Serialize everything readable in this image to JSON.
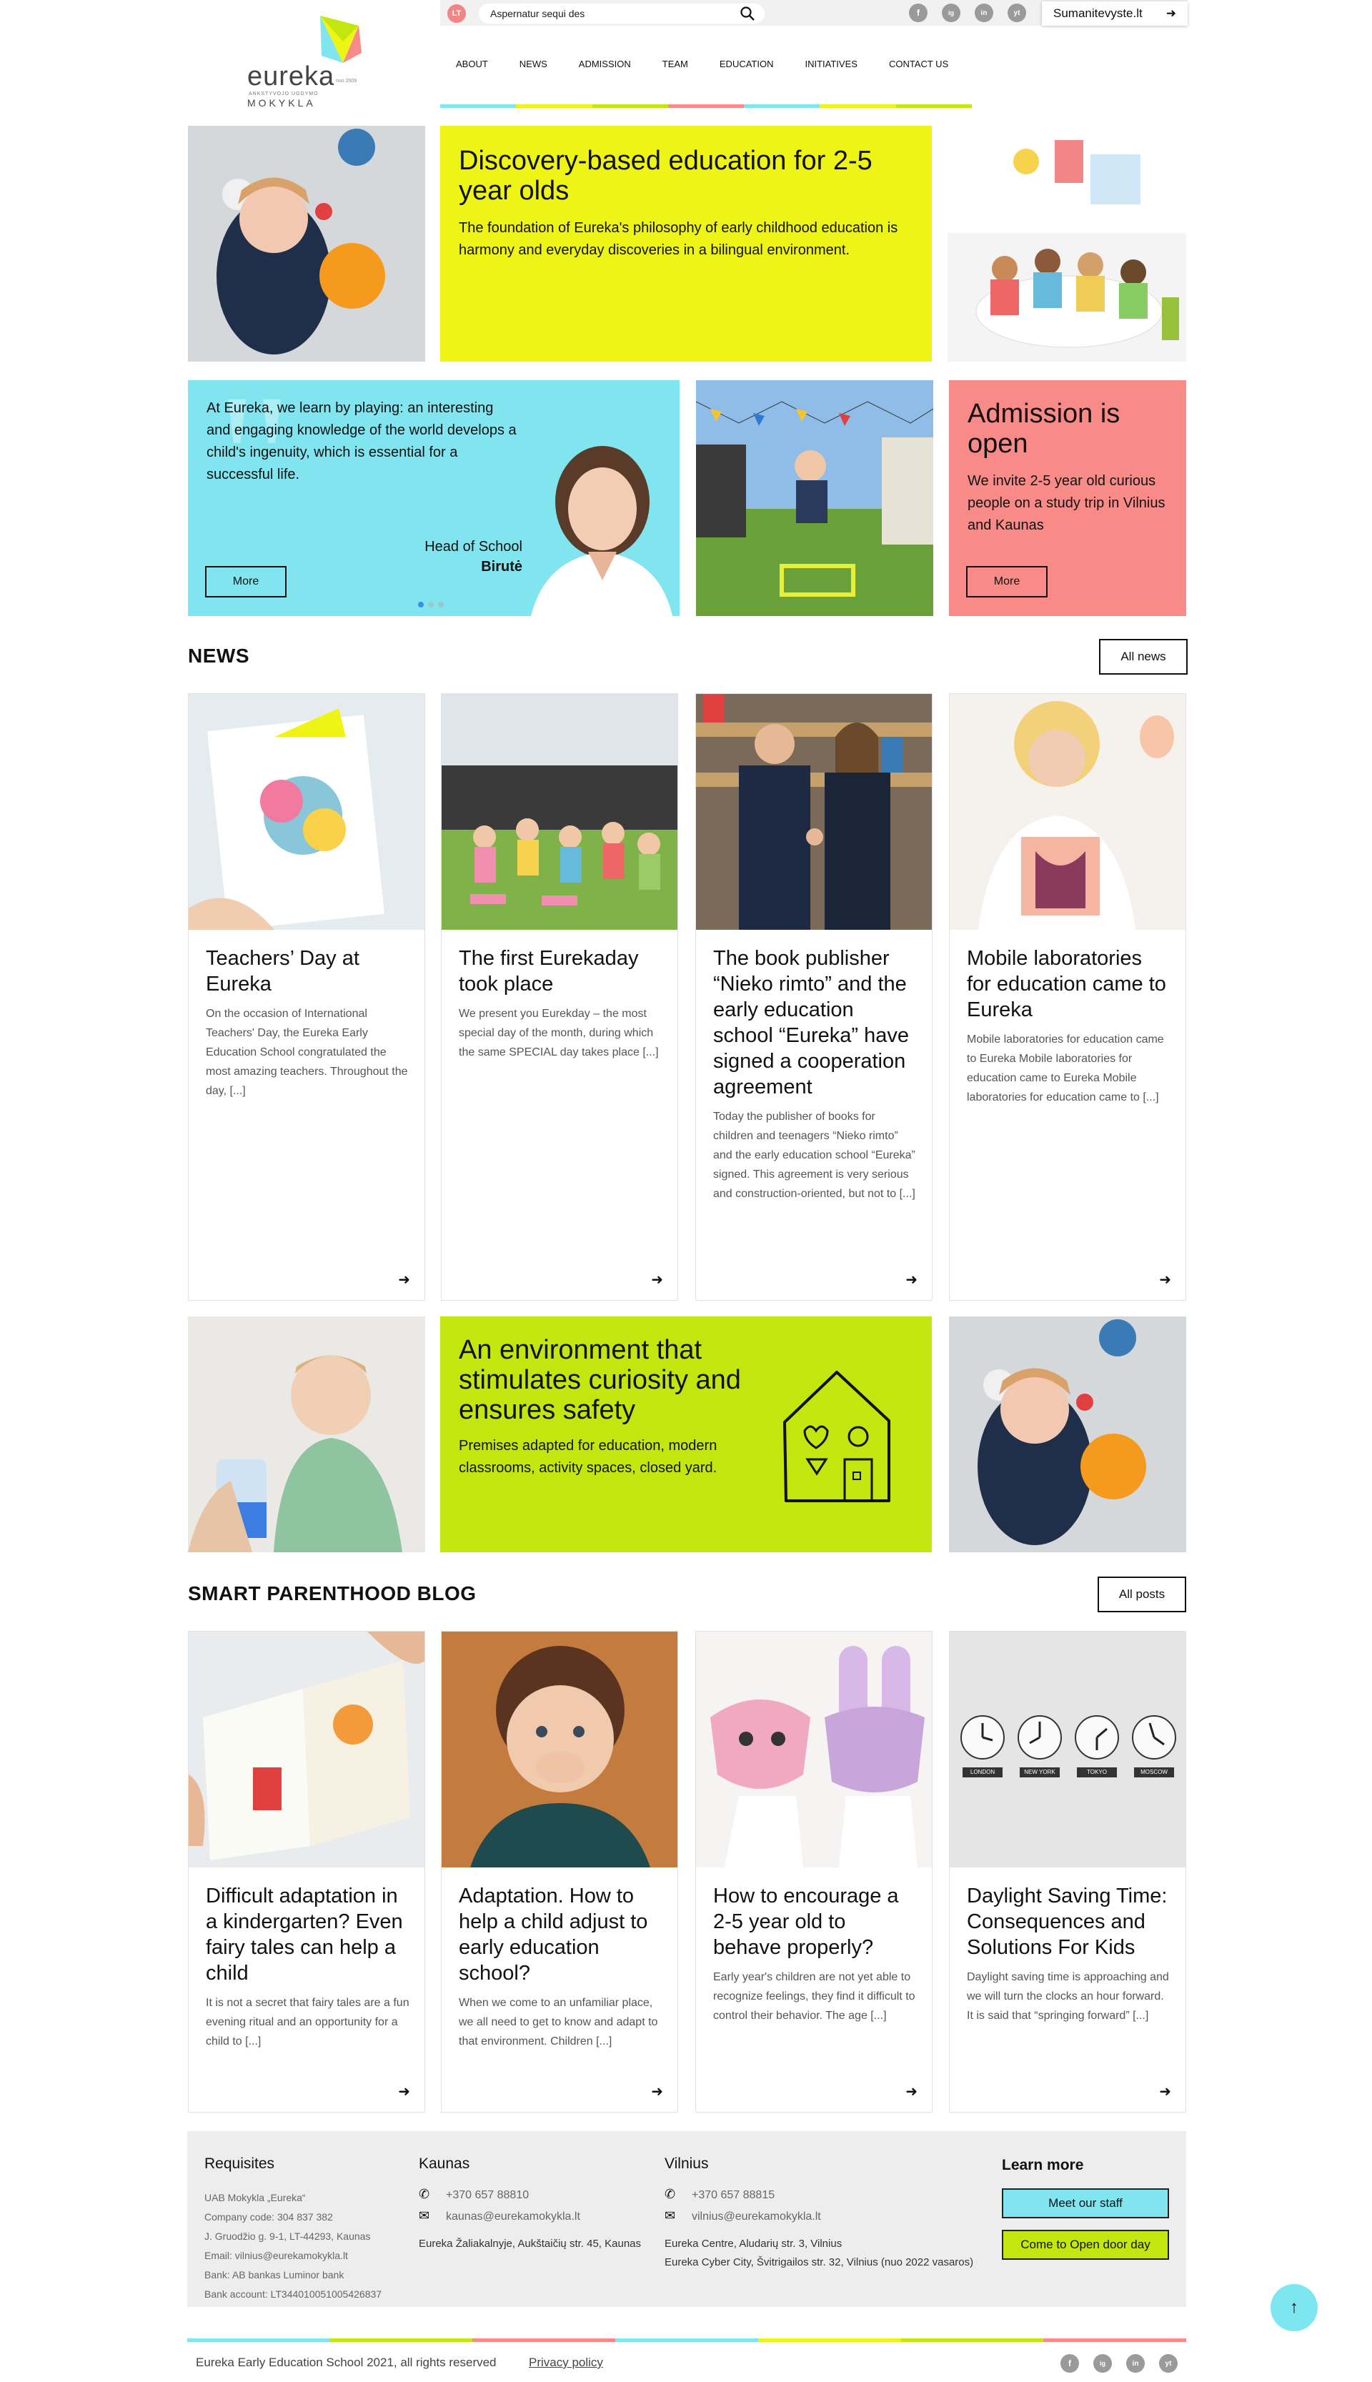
{
  "colors": {
    "yellow": "#eef514",
    "cyan": "#80e5ef",
    "salmon": "#f88a88",
    "lime": "#c4e60f",
    "blue": "#3d8fe0",
    "dark": "#111111"
  },
  "header": {
    "lang": "LT",
    "search_value": "Aspernatur sequi des",
    "social": [
      "f",
      "ig",
      "in",
      "yt"
    ],
    "external_link": "Sumanitevyste.lt",
    "logo_word": "eureka",
    "logo_small": "ANKSTYVOJO UGDYMO",
    "logo_school": "MOKYKLA",
    "logo_since": "nuo 2009",
    "nav": [
      "ABOUT",
      "NEWS",
      "ADMISSION",
      "TEAM",
      "EDUCATION",
      "INITIATIVES",
      "CONTACT US"
    ]
  },
  "hero": {
    "title": "Discovery-based education for 2-5 year olds",
    "text": "The foundation of Eureka's philosophy of early childhood education is harmony and everyday discoveries in a bilingual environment."
  },
  "quote": {
    "text": "At Eureka, we learn by playing: an interesting and engaging knowledge of the world develops a child's ingenuity, which is essential for a successful life.",
    "role": "Head of School",
    "name": "Birutė",
    "button": "More"
  },
  "admission": {
    "title": "Admission is open",
    "text": "We invite 2-5 year old curious people on a study trip in Vilnius and Kaunas",
    "button": "More"
  },
  "news": {
    "title": "NEWS",
    "all": "All news",
    "items": [
      {
        "title": "Teachers’ Day at Eureka",
        "text": "On the occasion of International Teachers' Day, the Eureka Early Education School congratulated the most amazing teachers. Throughout the day, [...]"
      },
      {
        "title": "The first Eurekaday took place",
        "text": "We present you Eurekday – the most special day of the month, during which the same SPECIAL day takes place [...]"
      },
      {
        "title": "The book publisher “Nieko rimto” and the early education school “Eureka” have signed a cooperation agreement",
        "text": "Today the publisher of books for children and teenagers “Nieko rimto” and the early education school “Eureka” signed. This agreement is very serious and construction-oriented, but not to [...]"
      },
      {
        "title": "Mobile laboratories for education came to Eureka",
        "text": "Mobile laboratories for education came to Eureka Mobile laboratories for education came to Eureka Mobile laboratories for education came to [...]"
      }
    ]
  },
  "environment": {
    "title": "An environment that stimulates curiosity and ensures safety",
    "text": "Premises adapted for education, modern classrooms, activity spaces, closed yard."
  },
  "blog": {
    "title": "SMART PARENTHOOD BLOG",
    "all": "All posts",
    "clock_labels": [
      "LONDON",
      "NEW YORK",
      "TOKYO",
      "MOSCOW"
    ],
    "items": [
      {
        "title": "Difficult adaptation in a kindergarten? Even fairy tales can help a child",
        "text": "It is not a secret that fairy tales are a fun evening ritual and an opportunity for a child to [...]"
      },
      {
        "title": "Adaptation. How to help a child adjust to early education school?",
        "text": "When we come to an unfamiliar place, we all need to get to know and adapt to that environment. Children [...]"
      },
      {
        "title": "How to encourage a 2-5 year old to behave properly?",
        "text": "Early year's children are not yet able to recognize feelings, they find it difficult to control their behavior. The age [...]"
      },
      {
        "title": "Daylight Saving Time: Consequences and Solutions For Kids",
        "text": "Daylight saving time is approaching and we will turn the clocks an hour forward. It is said that “springing forward” [...]"
      }
    ]
  },
  "footer": {
    "req_title": "Requisites",
    "req_lines": [
      "UAB Mokykla „Eureka“",
      "Company code: 304 837 382",
      "J. Gruodžio g. 9-1, LT-44293, Kaunas",
      "Email: vilnius@eurekamokykla.lt",
      "Bank: AB bankas Luminor bank",
      "Bank account: LT344010051005426837"
    ],
    "kaunas_title": "Kaunas",
    "kaunas_phone": "+370 657 88810",
    "kaunas_email": "kaunas@eurekamokykla.lt",
    "kaunas_addr": "Eureka Žaliakalnyje, Aukštaičių str. 45, Kaunas",
    "vilnius_title": "Vilnius",
    "vilnius_phone": "+370 657 88815",
    "vilnius_email": "vilnius@eurekamokykla.lt",
    "vilnius_addr1": "Eureka Centre, Aludarių str. 3, Vilnius",
    "vilnius_addr2": "Eureka Cyber City, Švitrigailos str. 32, Vilnius (nuo 2022 vasaros)",
    "learn_title": "Learn more",
    "btn_staff": "Meet our staff",
    "btn_open": "Come to Open door day",
    "copyright": "Eureka Early Education School 2021, all rights reserved",
    "privacy": "Privacy policy"
  }
}
